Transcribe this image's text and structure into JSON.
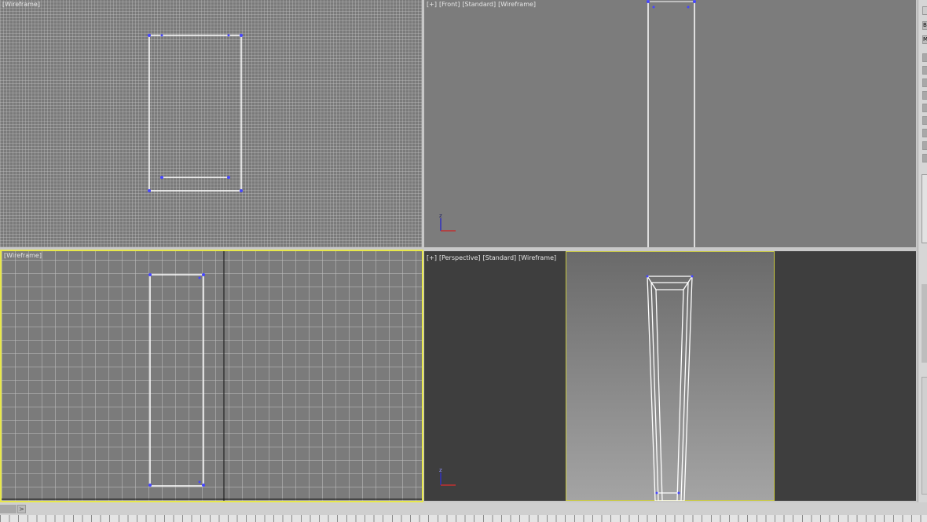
{
  "viewports": {
    "top": {
      "labels": [
        "[Wireframe]"
      ]
    },
    "front": {
      "labels": [
        "[+]",
        "[Front]",
        "[Standard]",
        "[Wireframe]"
      ]
    },
    "left": {
      "labels": [
        "[Wireframe]"
      ],
      "active": true
    },
    "perspective": {
      "labels": [
        "[+]",
        "[Perspective]",
        "[Standard]",
        "[Wireframe]"
      ]
    }
  },
  "axis": {
    "z": "z"
  },
  "side_panel": {
    "b": "B",
    "m": "M"
  },
  "timeline": {
    "next": ">"
  },
  "colors": {
    "active_border": "#e8e84a",
    "selection": "#ffffff",
    "vertex": "#3a3aff"
  }
}
